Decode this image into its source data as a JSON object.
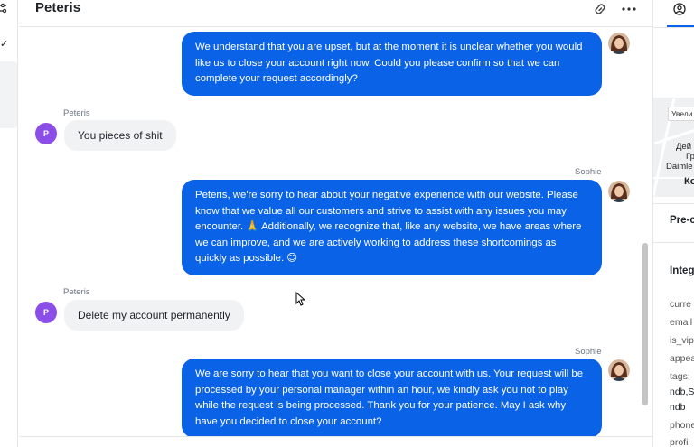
{
  "conversation": {
    "title": "Peteris"
  },
  "icons": {
    "link": "link-icon",
    "more": "more-horizontal-icon",
    "filter": "sliders-icon",
    "check": "check-icon",
    "user": "user-circle-icon"
  },
  "colors": {
    "accent": "#0a63e6",
    "incoming_bubble": "#f1f2f4",
    "customer_avatar": "#8b4ee8"
  },
  "messages": [
    {
      "direction": "outgoing",
      "sender": "",
      "text": "We understand that you are upset, but at the moment it is unclear whether you would like us to close your account right now. Could you please confirm so that we can complete your request accordingly?"
    },
    {
      "direction": "incoming",
      "sender": "Peteris",
      "avatar_initial": "P",
      "text": "You pieces of shit"
    },
    {
      "direction": "outgoing",
      "sender": "Sophie",
      "text": "Peteris, we're sorry to hear about your negative experience with our website. Please know that we value all our customers and strive to assist with any issues you may encounter. 🙏 Additionally, we recognize that, like any website, we have areas where we can improve, and we are actively working to address these shortcomings as quickly as possible. 😊"
    },
    {
      "direction": "incoming",
      "sender": "Peteris",
      "avatar_initial": "P",
      "text": "Delete my account permanently"
    },
    {
      "direction": "outgoing",
      "sender": "Sophie",
      "text": "We are sorry to hear that you want to close your account with us. Your request will be processed by your personal manager within an hour, we kindly ask you not to play while the request is being processed. Thank you for your patience. May I ask why have you decided to close your account?"
    }
  ],
  "right_panel": {
    "map": {
      "zoom_label": "Увели",
      "labels": [
        "Дей",
        "Гр",
        "Daimle",
        "Ко"
      ]
    },
    "section_pre": "Pre-c",
    "section_integ": "Integ",
    "fields": [
      "curre",
      "email",
      "is_vip",
      "appea",
      "tags:",
      "ndb,S",
      "ndb",
      "phone",
      "profil"
    ]
  }
}
